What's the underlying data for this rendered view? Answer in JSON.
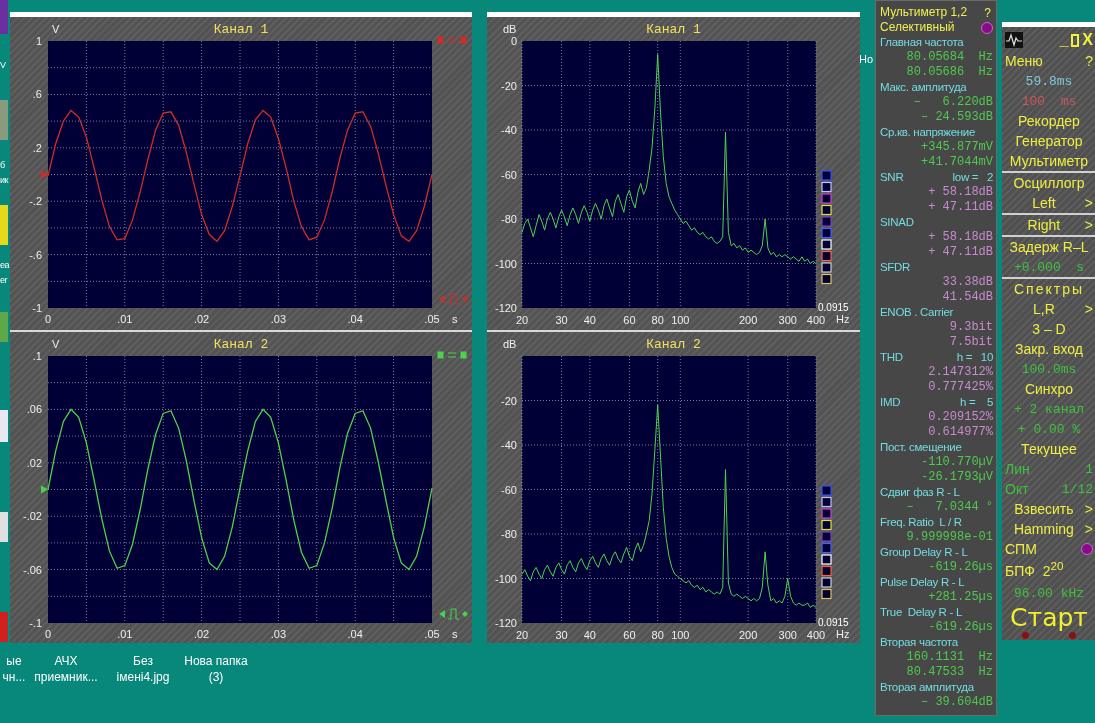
{
  "desktop": {
    "edge_labels": [
      "V",
      "б",
      "ик",
      "ea",
      "er"
    ],
    "stray_label": "Но",
    "icons": [
      {
        "lines": [
          "ые",
          "чн..."
        ]
      },
      {
        "lines": [
          "АЧХ",
          "приемник..."
        ]
      },
      {
        "lines": [
          "Без",
          "імені4.jpg"
        ]
      },
      {
        "lines": [
          "Нова папка",
          "(3)"
        ]
      }
    ]
  },
  "oscilloscope": {
    "panels": [
      {
        "kind": "scope",
        "chart_data": {
          "type": "line",
          "title": "Канал 1",
          "xlabel": "s",
          "ylabel": "V",
          "xlim": [
            0,
            0.05
          ],
          "ylim": [
            -1,
            1
          ],
          "xticks": [
            {
              "value": 0,
              "label": "0"
            },
            {
              "value": 0.01,
              "label": ".01"
            },
            {
              "value": 0.02,
              "label": ".02"
            },
            {
              "value": 0.03,
              "label": ".03"
            },
            {
              "value": 0.04,
              "label": ".04"
            },
            {
              "value": 0.05,
              "label": ".05"
            }
          ],
          "yticks": [
            {
              "value": 1,
              "label": "1"
            },
            {
              "value": 0.6,
              "label": ".6"
            },
            {
              "value": 0.2,
              "label": ".2"
            },
            {
              "value": -0.2,
              "label": "-.2"
            },
            {
              "value": -0.6,
              "label": "-.6"
            },
            {
              "value": -1,
              "label": "-1"
            }
          ],
          "x": [
            0,
            0.001,
            0.002,
            0.003,
            0.004,
            0.005,
            0.006,
            0.007,
            0.008,
            0.009,
            0.01,
            0.011,
            0.012,
            0.013,
            0.014,
            0.015,
            0.016,
            0.017,
            0.018,
            0.019,
            0.02,
            0.021,
            0.022,
            0.023,
            0.024,
            0.025,
            0.026,
            0.027,
            0.028,
            0.029,
            0.03,
            0.031,
            0.032,
            0.033,
            0.034,
            0.035,
            0.036,
            0.037,
            0.038,
            0.039,
            0.04,
            0.041,
            0.042,
            0.043,
            0.044,
            0.045,
            0.046,
            0.047,
            0.048,
            0.049,
            0.05
          ],
          "grid": true,
          "series": [
            {
              "color": "#d42a2a",
              "values": [
                -0.01,
                0.23,
                0.4,
                0.48,
                0.43,
                0.28,
                0.05,
                -0.19,
                -0.39,
                -0.49,
                -0.48,
                -0.34,
                -0.13,
                0.11,
                0.33,
                0.46,
                0.47,
                0.37,
                0.17,
                -0.07,
                -0.3,
                -0.45,
                -0.5,
                -0.42,
                -0.24,
                -0.01,
                0.23,
                0.41,
                0.48,
                0.43,
                0.27,
                0.05,
                -0.2,
                -0.39,
                -0.49,
                -0.47,
                -0.34,
                -0.13,
                0.12,
                0.33,
                0.46,
                0.47,
                0.36,
                0.16,
                -0.08,
                -0.3,
                -0.46,
                -0.5,
                -0.42,
                -0.24,
                0.0
              ]
            }
          ]
        }
      },
      {
        "kind": "scope",
        "chart_data": {
          "type": "line",
          "title": "Канал 2",
          "xlabel": "s",
          "ylabel": "V",
          "xlim": [
            0,
            0.05
          ],
          "ylim": [
            -0.1,
            0.1
          ],
          "xticks": [
            {
              "value": 0,
              "label": "0"
            },
            {
              "value": 0.01,
              "label": ".01"
            },
            {
              "value": 0.02,
              "label": ".02"
            },
            {
              "value": 0.03,
              "label": ".03"
            },
            {
              "value": 0.04,
              "label": ".04"
            },
            {
              "value": 0.05,
              "label": ".05"
            }
          ],
          "yticks": [
            {
              "value": 0.1,
              "label": ".1"
            },
            {
              "value": 0.06,
              "label": ".06"
            },
            {
              "value": 0.02,
              "label": ".02"
            },
            {
              "value": -0.02,
              "label": "-.02"
            },
            {
              "value": -0.06,
              "label": "-.06"
            },
            {
              "value": -0.1,
              "label": "-.1"
            }
          ],
          "x": [
            0,
            0.001,
            0.002,
            0.003,
            0.004,
            0.005,
            0.006,
            0.007,
            0.008,
            0.009,
            0.01,
            0.011,
            0.012,
            0.013,
            0.014,
            0.015,
            0.016,
            0.017,
            0.018,
            0.019,
            0.02,
            0.021,
            0.022,
            0.023,
            0.024,
            0.025,
            0.026,
            0.027,
            0.028,
            0.029,
            0.03,
            0.031,
            0.032,
            0.033,
            0.034,
            0.035,
            0.036,
            0.037,
            0.038,
            0.039,
            0.04,
            0.041,
            0.042,
            0.043,
            0.044,
            0.045,
            0.046,
            0.047,
            0.048,
            0.049,
            0.05
          ],
          "grid": true,
          "series": [
            {
              "color": "#4cd34c",
              "values": [
                0,
                0.029,
                0.051,
                0.06,
                0.054,
                0.035,
                0.007,
                -0.022,
                -0.046,
                -0.059,
                -0.057,
                -0.041,
                -0.015,
                0.015,
                0.041,
                0.057,
                0.059,
                0.046,
                0.022,
                -0.008,
                -0.036,
                -0.055,
                -0.06,
                -0.05,
                -0.028,
                0.001,
                0.029,
                0.051,
                0.06,
                0.054,
                0.035,
                0.007,
                -0.023,
                -0.047,
                -0.059,
                -0.057,
                -0.04,
                -0.014,
                0.016,
                0.042,
                0.057,
                0.059,
                0.046,
                0.021,
                -0.008,
                -0.036,
                -0.055,
                -0.06,
                -0.05,
                -0.028,
                0.001
              ]
            }
          ]
        }
      }
    ]
  },
  "spectrum": {
    "panels": [
      {
        "kind": "spectrum",
        "readout": "0.0915",
        "chart_data": {
          "type": "line",
          "title": "Канал 1",
          "xlabel": "Hz",
          "ylabel": "dB",
          "ylim": [
            -120,
            0
          ],
          "yticks": [
            0,
            -20,
            -40,
            -60,
            -80,
            -100,
            -120
          ],
          "categories": [
            "20",
            null,
            null,
            null,
            null,
            null,
            null,
            null,
            null,
            null,
            null,
            null,
            null,
            null,
            "30",
            null,
            null,
            null,
            null,
            null,
            null,
            null,
            null,
            null,
            "40",
            null,
            null,
            null,
            null,
            null,
            null,
            null,
            null,
            null,
            null,
            null,
            null,
            null,
            "60",
            null,
            null,
            null,
            null,
            null,
            null,
            null,
            null,
            null,
            "80",
            null,
            null,
            null,
            null,
            null,
            null,
            null,
            "100",
            null,
            null,
            null,
            null,
            null,
            null,
            null,
            null,
            null,
            null,
            null,
            null,
            null,
            null,
            null,
            null,
            null,
            null,
            null,
            null,
            null,
            null,
            null,
            "200",
            null,
            null,
            null,
            null,
            null,
            null,
            null,
            null,
            null,
            null,
            null,
            null,
            null,
            "300",
            null,
            null,
            null,
            null,
            null,
            null,
            null,
            null,
            null,
            "400"
          ],
          "grid": true,
          "series": [
            {
              "color": "#4cd34c",
              "values": [
                -86,
                -82,
                -80,
                -84,
                -88,
                -83,
                -78,
                -81,
                -85,
                -80,
                -77,
                -80,
                -84,
                -79,
                -76,
                -79,
                -83,
                -78,
                -75,
                -78,
                -82,
                -77,
                -74,
                -77,
                -81,
                -76,
                -73,
                -76,
                -80,
                -74,
                -71,
                -75,
                -79,
                -72,
                -69,
                -73,
                -77,
                -70,
                -67,
                -72,
                -75,
                -68,
                -64,
                -69,
                -66,
                -58,
                -48,
                -30,
                -6,
                -32,
                -52,
                -64,
                -70,
                -73,
                -76,
                -78,
                -80,
                -82,
                -81,
                -83,
                -85,
                -84,
                -86,
                -87,
                -86,
                -88,
                -89,
                -88,
                -90,
                -91,
                -90,
                -88,
                -41,
                -86,
                -92,
                -91,
                -93,
                -92,
                -94,
                -93,
                -95,
                -94,
                -95,
                -96,
                -95,
                -92,
                -80,
                -93,
                -96,
                -95,
                -97,
                -96,
                -97,
                -96,
                -97,
                -98,
                -97,
                -98,
                -99,
                -97,
                -99,
                -98,
                -100,
                -99,
                -100
              ]
            }
          ]
        }
      },
      {
        "kind": "spectrum",
        "readout": "0.0915",
        "chart_data": {
          "type": "line",
          "title": "Канал 2",
          "xlabel": "Hz",
          "ylabel": "dB",
          "ylim": [
            -120,
            0
          ],
          "yticks": [
            -20,
            -40,
            -60,
            -80,
            -100,
            -120
          ],
          "categories": [
            "20",
            null,
            null,
            null,
            null,
            null,
            null,
            null,
            null,
            null,
            null,
            null,
            null,
            null,
            "30",
            null,
            null,
            null,
            null,
            null,
            null,
            null,
            null,
            null,
            "40",
            null,
            null,
            null,
            null,
            null,
            null,
            null,
            null,
            null,
            null,
            null,
            null,
            null,
            "60",
            null,
            null,
            null,
            null,
            null,
            null,
            null,
            null,
            null,
            "80",
            null,
            null,
            null,
            null,
            null,
            null,
            null,
            "100",
            null,
            null,
            null,
            null,
            null,
            null,
            null,
            null,
            null,
            null,
            null,
            null,
            null,
            null,
            null,
            null,
            null,
            null,
            null,
            null,
            null,
            null,
            null,
            "200",
            null,
            null,
            null,
            null,
            null,
            null,
            null,
            null,
            null,
            null,
            null,
            null,
            null,
            "300",
            null,
            null,
            null,
            null,
            null,
            null,
            null,
            null,
            null,
            "400"
          ],
          "grid": true,
          "series": [
            {
              "color": "#4cd34c",
              "values": [
                -98,
                -96,
                -99,
                -101,
                -97,
                -95,
                -98,
                -100,
                -96,
                -94,
                -97,
                -99,
                -95,
                -93,
                -96,
                -98,
                -94,
                -92,
                -95,
                -97,
                -93,
                -91,
                -94,
                -96,
                -92,
                -90,
                -93,
                -95,
                -91,
                -89,
                -92,
                -94,
                -90,
                -88,
                -91,
                -93,
                -89,
                -86,
                -90,
                -92,
                -87,
                -84,
                -88,
                -85,
                -80,
                -74,
                -62,
                -42,
                -22,
                -45,
                -68,
                -82,
                -90,
                -95,
                -98,
                -99,
                -100,
                -101,
                -102,
                -101,
                -103,
                -104,
                -103,
                -105,
                -104,
                -106,
                -105,
                -106,
                -107,
                -106,
                -107,
                -104,
                -51,
                -102,
                -107,
                -108,
                -107,
                -108,
                -109,
                -108,
                -109,
                -110,
                -109,
                -110,
                -109,
                -104,
                -88,
                -103,
                -110,
                -109,
                -111,
                -110,
                -111,
                -108,
                -100,
                -108,
                -111,
                -112,
                -111,
                -112,
                -112,
                -111,
                -113,
                -112,
                -113
              ]
            }
          ]
        }
      }
    ]
  },
  "multimeter": {
    "title": "Мультиметр 1,2",
    "help": "?",
    "mode": {
      "label": "Селективный",
      "on": true
    },
    "rows": [
      {
        "kind": "heading",
        "text": "Главная частота"
      },
      {
        "kind": "value",
        "text": "80.05684  Hz",
        "color": "#4fc94f"
      },
      {
        "kind": "value",
        "text": "80.05686  Hz",
        "color": "#4fc94f"
      },
      {
        "kind": "heading",
        "text": "Макс. амплитуда"
      },
      {
        "kind": "value",
        "text": "–   6.220dB",
        "color": "#4fc94f"
      },
      {
        "kind": "value",
        "text": "– 24.593dB",
        "color": "#4fc94f"
      },
      {
        "kind": "heading",
        "text": "Ср.кв. напряжение"
      },
      {
        "kind": "value",
        "text": "+345.877mV",
        "color": "#4fc94f"
      },
      {
        "kind": "value",
        "text": "+41.7044mV",
        "color": "#4fc94f"
      },
      {
        "kind": "heading",
        "text": "SNR",
        "aside": "low =   2"
      },
      {
        "kind": "value",
        "text": "+ 58.18dB",
        "color": "#c98ad0"
      },
      {
        "kind": "value",
        "text": "+ 47.11dB",
        "color": "#c98ad0"
      },
      {
        "kind": "heading",
        "text": "SINAD"
      },
      {
        "kind": "value",
        "text": "+ 58.18dB",
        "color": "#c98ad0"
      },
      {
        "kind": "value",
        "text": "+ 47.11dB",
        "color": "#c98ad0"
      },
      {
        "kind": "heading",
        "text": "SFDR"
      },
      {
        "kind": "value",
        "text": "33.38dB",
        "color": "#c98ad0"
      },
      {
        "kind": "value",
        "text": "41.54dB",
        "color": "#c98ad0"
      },
      {
        "kind": "heading",
        "text": "ENOB . Carrier"
      },
      {
        "kind": "value",
        "text": "9.3bit",
        "color": "#c98ad0"
      },
      {
        "kind": "value",
        "text": "7.5bit",
        "color": "#c98ad0"
      },
      {
        "kind": "heading",
        "text": "THD",
        "aside": "h =   10"
      },
      {
        "kind": "value",
        "text": "2.147312%",
        "color": "#c98ad0"
      },
      {
        "kind": "value",
        "text": "0.777425%",
        "color": "#c98ad0"
      },
      {
        "kind": "heading",
        "text": "IMD",
        "aside": "h =    5"
      },
      {
        "kind": "value",
        "text": "0.209152%",
        "color": "#c98ad0"
      },
      {
        "kind": "value",
        "text": "0.614977%",
        "color": "#c98ad0"
      },
      {
        "kind": "heading",
        "text": "Пост. смещение"
      },
      {
        "kind": "value",
        "text": "-110.770µV",
        "color": "#4fc94f"
      },
      {
        "kind": "value",
        "text": "-26.1793µV",
        "color": "#4fc94f"
      },
      {
        "kind": "heading",
        "text": "Сдвиг фаз R - L"
      },
      {
        "kind": "value",
        "text": "–   7.0344 °",
        "color": "#4fc94f"
      },
      {
        "kind": "heading",
        "text": "Freq. Ratio  L / R"
      },
      {
        "kind": "value",
        "text": "9.999998e-01",
        "color": "#4fc94f"
      },
      {
        "kind": "heading",
        "text": "Group Delay R - L"
      },
      {
        "kind": "value",
        "text": "-619.26µs",
        "color": "#4fc94f"
      },
      {
        "kind": "heading",
        "text": "Pulse Delay R - L"
      },
      {
        "kind": "value",
        "text": "+281.25µs",
        "color": "#4fc94f"
      },
      {
        "kind": "heading",
        "text": "True  Delay R - L"
      },
      {
        "kind": "value",
        "text": "-619.26µs",
        "color": "#4fc94f"
      },
      {
        "kind": "heading",
        "text": "Вторая частота"
      },
      {
        "kind": "value",
        "text": "160.1131  Hz",
        "color": "#4fc94f"
      },
      {
        "kind": "value",
        "text": "80.47533  Hz",
        "color": "#4fc94f"
      },
      {
        "kind": "heading",
        "text": "Вторая амплитуда"
      },
      {
        "kind": "value",
        "text": "– 39.604dB",
        "color": "#4fc94f"
      }
    ]
  },
  "control_panel": {
    "controls": [
      {
        "kind": "text",
        "text": "_"
      },
      {
        "kind": "maximize"
      },
      {
        "kind": "text",
        "text": "X"
      }
    ],
    "rows": [
      {
        "kind": "menu",
        "text": "Меню",
        "help": "?"
      },
      {
        "kind": "value",
        "text": "59.8ms",
        "color": "#7fc8d8"
      },
      {
        "kind": "value",
        "text": "100  ms",
        "color": "#c85858"
      },
      {
        "kind": "button",
        "text": "Рекордер"
      },
      {
        "kind": "button",
        "text": "Генератор"
      },
      {
        "kind": "button",
        "text": "Мультиметр",
        "rule_below": true
      },
      {
        "kind": "button",
        "text": "Осциллогр"
      },
      {
        "kind": "button",
        "text": "Left",
        "arrow": ">",
        "rule_below": true
      },
      {
        "kind": "button",
        "text": "Right",
        "arrow": ">",
        "rule_below": true
      },
      {
        "kind": "button",
        "text": "Задерж R–L"
      },
      {
        "kind": "value",
        "text": "+0.000  s",
        "color": "#3ec03e",
        "rule_below": true
      },
      {
        "kind": "button",
        "text": "Спектры",
        "spaced": true
      },
      {
        "kind": "button",
        "text": "L,R",
        "arrow": ">"
      },
      {
        "kind": "button",
        "text": "3 – D"
      },
      {
        "kind": "button",
        "text": "Закр. вход"
      },
      {
        "kind": "value",
        "text": "100.0ms",
        "color": "#3ec03e"
      },
      {
        "kind": "button",
        "text": "Синхро"
      },
      {
        "kind": "value",
        "text": "+ 2 канал",
        "color": "#3ec03e"
      },
      {
        "kind": "value",
        "text": "+ 0.00 %",
        "color": "#3ec03e"
      },
      {
        "kind": "button",
        "text": "Текущее"
      },
      {
        "kind": "pair",
        "text": "Лин",
        "value": "1",
        "color": "#3ec03e"
      },
      {
        "kind": "pair",
        "text": "Окт",
        "value": "1/12",
        "color": "#3ec03e"
      },
      {
        "kind": "button",
        "text": "Взвесить",
        "arrow": ">"
      },
      {
        "kind": "button",
        "text": "Hamming",
        "arrow": ">"
      },
      {
        "kind": "toggle",
        "text": "СПМ",
        "on": true
      },
      {
        "kind": "formula",
        "text": "БПФ  2$^{20}$"
      },
      {
        "kind": "value",
        "text": "96.00 kHz",
        "color": "#3ec03e"
      },
      {
        "kind": "start",
        "text": "Старт"
      }
    ]
  }
}
